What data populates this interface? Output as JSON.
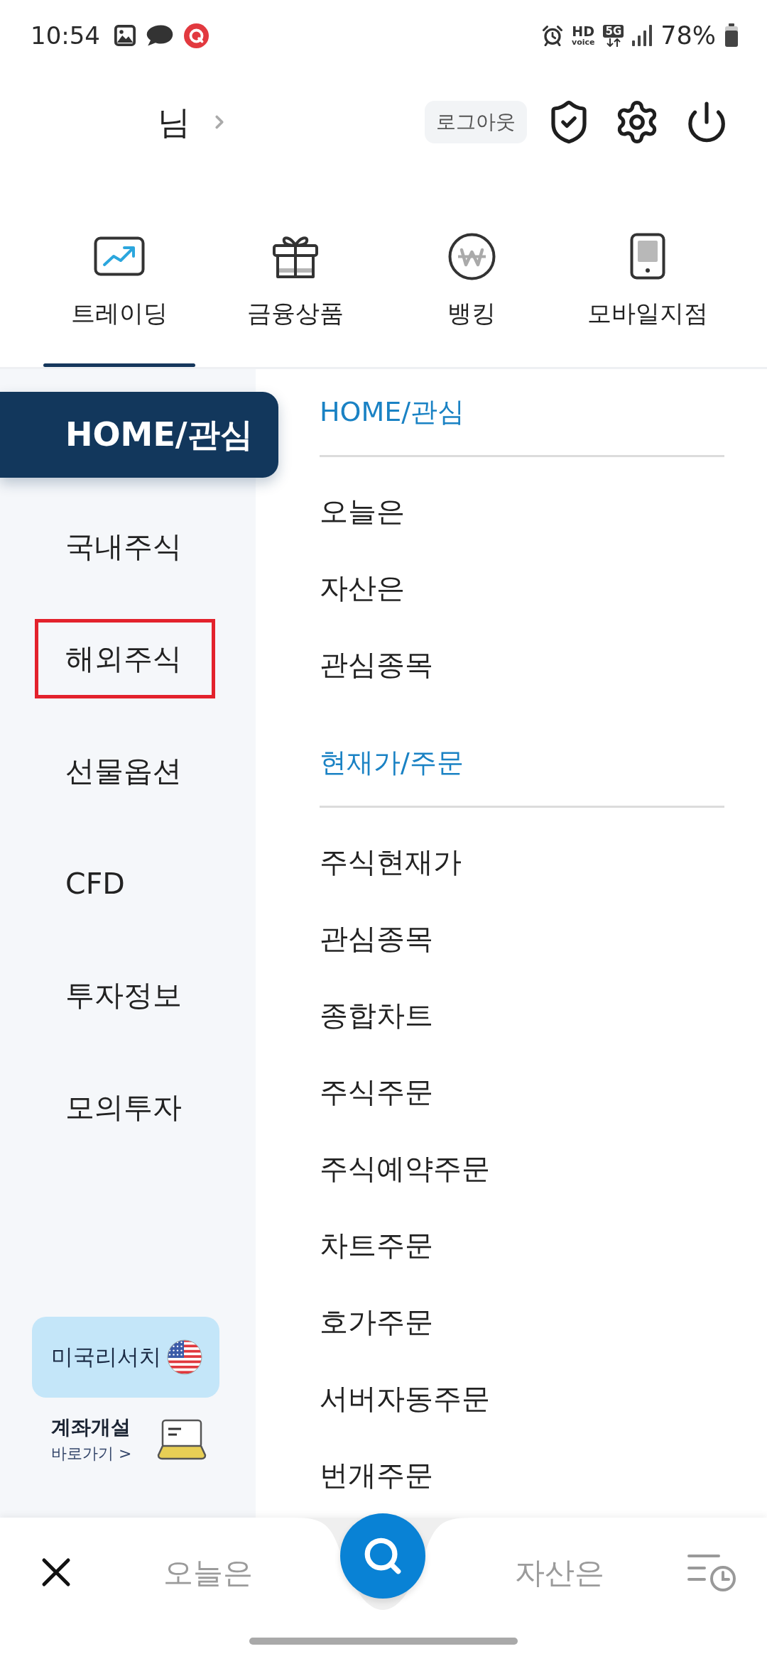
{
  "status_bar": {
    "time": "10:54",
    "hd": "HD",
    "voice": "voice",
    "network": "5G",
    "battery": "78%"
  },
  "header": {
    "user": "님",
    "logout": "로그아웃"
  },
  "tabs": [
    {
      "label": "트레이딩",
      "selected": true
    },
    {
      "label": "금융상품",
      "selected": false
    },
    {
      "label": "뱅킹",
      "selected": false
    },
    {
      "label": "모바일지점",
      "selected": false
    }
  ],
  "sidebar": {
    "items": [
      {
        "label": "HOME/관심",
        "selected": true,
        "highlighted": false
      },
      {
        "label": "국내주식",
        "selected": false,
        "highlighted": false
      },
      {
        "label": "해외주식",
        "selected": false,
        "highlighted": true
      },
      {
        "label": "선물옵션",
        "selected": false,
        "highlighted": false
      },
      {
        "label": "CFD",
        "selected": false,
        "highlighted": false
      },
      {
        "label": "투자정보",
        "selected": false,
        "highlighted": false
      },
      {
        "label": "모의투자",
        "selected": false,
        "highlighted": false
      }
    ],
    "research": {
      "label": "미국리서치"
    },
    "account": {
      "title": "계좌개설",
      "link": "바로가기 >"
    }
  },
  "menu": [
    {
      "title": "HOME/관심",
      "items": [
        "오늘은",
        "자산은",
        "관심종목"
      ]
    },
    {
      "title": "현재가/주문",
      "items": [
        "주식현재가",
        "관심종목",
        "종합차트",
        "주식주문",
        "주식예약주문",
        "차트주문",
        "호가주문",
        "서버자동주문",
        "번개주문"
      ]
    }
  ],
  "bottom_nav": {
    "left": "오늘은",
    "right": "자산은"
  }
}
